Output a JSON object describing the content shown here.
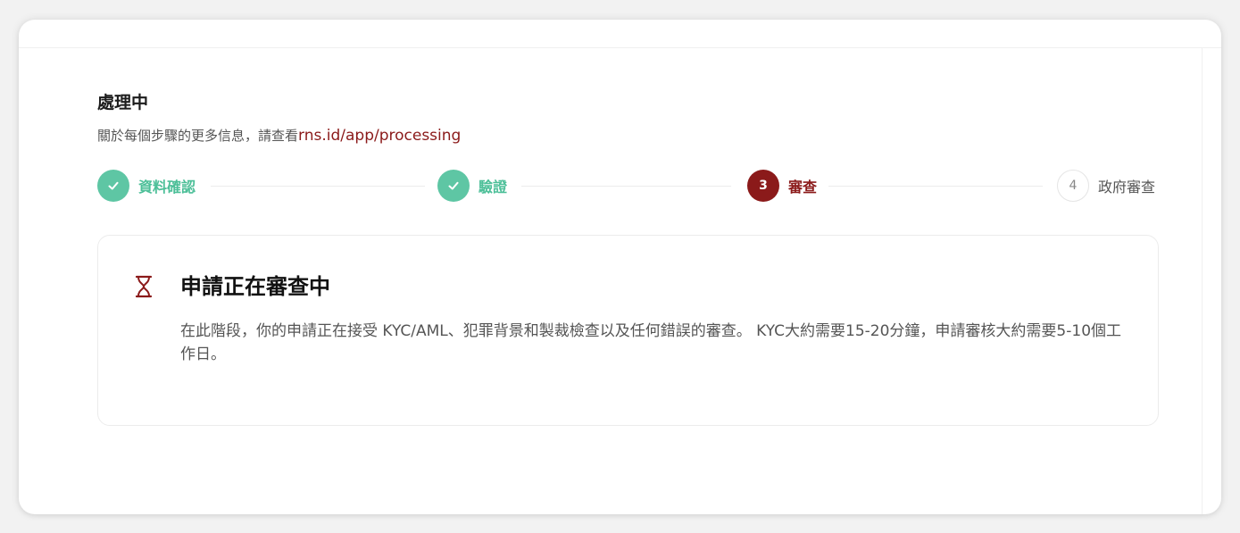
{
  "header": {
    "title": "處理中",
    "subtitle_prefix": "關於每個步驟的更多信息，請查看",
    "subtitle_link": "rns.id/app/processing"
  },
  "stepper": {
    "steps": [
      {
        "number": "",
        "label": "資料確認",
        "state": "done",
        "icon": "check-icon"
      },
      {
        "number": "",
        "label": "驗證",
        "state": "done",
        "icon": "check-icon"
      },
      {
        "number": "3",
        "label": "審查",
        "state": "active"
      },
      {
        "number": "4",
        "label": "政府審查",
        "state": "todo"
      }
    ]
  },
  "panel": {
    "icon": "hourglass-icon",
    "heading": "申請正在審查中",
    "body": "在此階段，你的申請正在接受 KYC/AML、犯罪背景和製裁檢查以及任何錯誤的審查。 KYC大約需要15-20分鐘，申請審核大約需要5-10個工作日。"
  },
  "colors": {
    "done": "#5ec6a4",
    "active": "#8b1a1a",
    "link": "#8b1a1a"
  }
}
